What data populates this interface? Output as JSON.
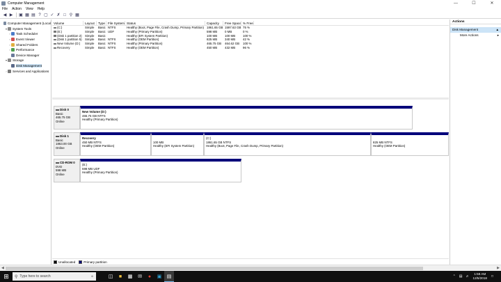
{
  "window": {
    "title": "Computer Management",
    "minimize": "—",
    "maximize": "☐",
    "close": "✕"
  },
  "menu": [
    "File",
    "Action",
    "View",
    "Help"
  ],
  "tree": [
    {
      "label": "Computer Management (Local",
      "level": 0,
      "twisty": "",
      "color": "#7a8aa0"
    },
    {
      "label": "System Tools",
      "level": 1,
      "twisty": "▾",
      "color": "#8a8a8a"
    },
    {
      "label": "Task Scheduler",
      "level": 2,
      "twisty": "›",
      "color": "#4a7bc8"
    },
    {
      "label": "Event Viewer",
      "level": 2,
      "twisty": "›",
      "color": "#d05050"
    },
    {
      "label": "Shared Folders",
      "level": 2,
      "twisty": "›",
      "color": "#e0b040"
    },
    {
      "label": "Performance",
      "level": 2,
      "twisty": "›",
      "color": "#50a050"
    },
    {
      "label": "Device Manager",
      "level": 2,
      "twisty": "",
      "color": "#6a7a9a"
    },
    {
      "label": "Storage",
      "level": 1,
      "twisty": "▾",
      "color": "#8a8a8a"
    },
    {
      "label": "Disk Management",
      "level": 2,
      "twisty": "",
      "color": "#5a6a8a",
      "selected": true
    },
    {
      "label": "Services and Applications",
      "level": 1,
      "twisty": "›",
      "color": "#7a7a7a"
    }
  ],
  "volume_table": {
    "headers": [
      "Volume",
      "Layout",
      "Type",
      "File System",
      "Status",
      "Capacity",
      "Free Space",
      "% Free"
    ],
    "rows": [
      [
        "(C:)",
        "Simple",
        "Basic",
        "NTFS",
        "Healthy (Boot, Page File, Crash Dump, Primary Partition)",
        "1861.65 GB",
        "1597.63 GB",
        "75 %"
      ],
      [
        "(E:)",
        "Simple",
        "Basic",
        "UDF",
        "Healthy (Primary Partition)",
        "598 MB",
        "0 MB",
        "0 %"
      ],
      [
        "(Disk 1 partition 2)",
        "Simple",
        "Basic",
        "",
        "Healthy (EFI System Partition)",
        "100 MB",
        "100 MB",
        "100 %"
      ],
      [
        "(Disk 1 partition 5)",
        "Simple",
        "Basic",
        "NTFS",
        "Healthy (OEM Partition)",
        "825 MB",
        "340 MB",
        "42 %"
      ],
      [
        "New Volume (D:)",
        "Simple",
        "Basic",
        "NTFS",
        "Healthy (Primary Partition)",
        "465.75 GB",
        "464.62 GB",
        "100 %"
      ],
      [
        "Recovery",
        "Simple",
        "Basic",
        "NTFS",
        "Healthy (OEM Partition)",
        "450 MB",
        "432 MB",
        "96 %"
      ]
    ]
  },
  "disks": [
    {
      "name": "Disk 0",
      "kind": "Basic",
      "size": "465.75 GB",
      "state": "Online",
      "partitions": [
        {
          "name": "New Volume (D:)",
          "detail": "465.75 GB NTFS",
          "status": "Healthy (Primary Partition)"
        }
      ]
    },
    {
      "name": "Disk 1",
      "kind": "Basic",
      "size": "1863.00 GB",
      "state": "Online",
      "partitions": [
        {
          "name": "Recovery",
          "detail": "450 MB NTFS",
          "status": "Healthy (OEM Partition)"
        },
        {
          "name": "",
          "detail": "100 MB",
          "status": "Healthy (EFI System Partition)"
        },
        {
          "name": "",
          "detail": "(C:)",
          "detail2": "1861.65 GB NTFS",
          "status": "Healthy (Boot, Page File, Crash Dump, Primary Partition)"
        },
        {
          "name": "",
          "detail": "825 MB NTFS",
          "status": "Healthy (OEM Partition)"
        }
      ]
    },
    {
      "name": "CD-ROM 0",
      "kind": "DVD",
      "size": "598 MB",
      "state": "Online",
      "partitions": [
        {
          "name": "",
          "detail": "(E:)",
          "detail2": "598 MB UDF",
          "status": "Healthy (Primary Partition)"
        }
      ]
    }
  ],
  "legend": [
    "Unallocated",
    "Primary partition"
  ],
  "actions": {
    "header": "Actions",
    "selected": "Disk Management",
    "more": "More Actions"
  },
  "taskbar": {
    "search_placeholder": "Type here to search",
    "time": "1:58 AM",
    "date": "12/5/2018"
  }
}
